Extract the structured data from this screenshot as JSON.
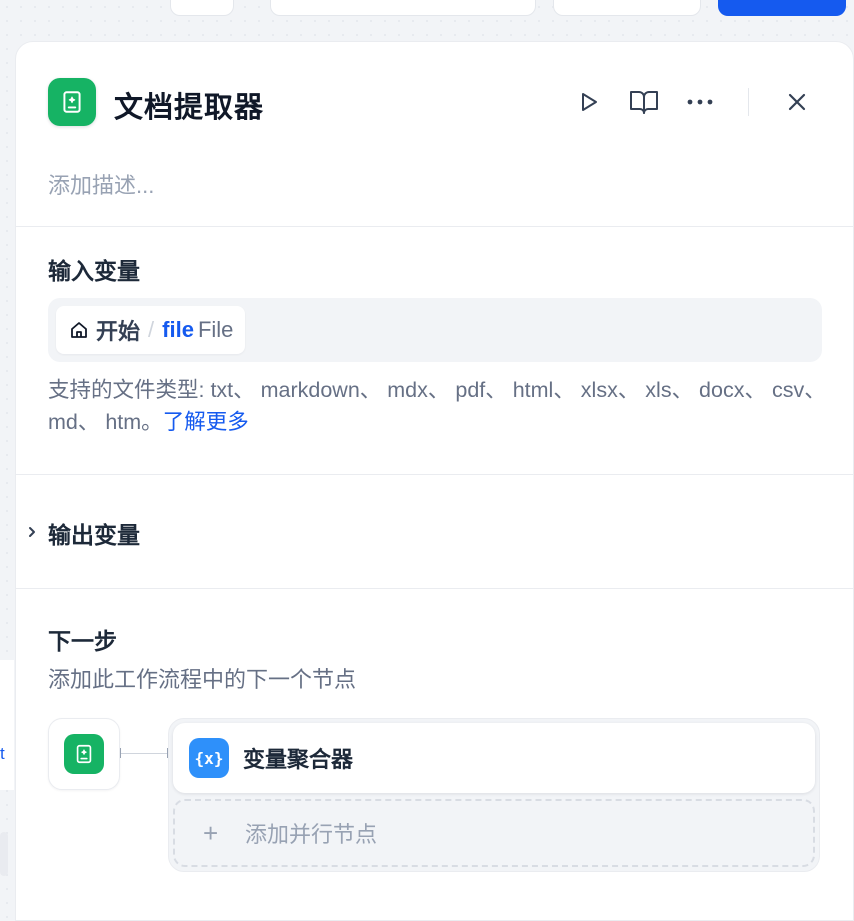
{
  "node": {
    "title": "文档提取器",
    "description_placeholder": "添加描述...",
    "icon": "document-extractor-icon",
    "accent_color": "#16b364"
  },
  "header_actions": [
    "run-icon",
    "docs-book-icon",
    "more-icon",
    "close-icon"
  ],
  "input": {
    "section_title": "输入变量",
    "variable": {
      "node_name": "开始",
      "separator": "/",
      "var_name": "file",
      "var_type": "File"
    },
    "supported_text": "支持的文件类型: txt、 markdown、 mdx、 pdf、 html、 xlsx、 xls、 docx、 csv、 md、 htm。",
    "learn_more": "了解更多"
  },
  "output": {
    "section_title": "输出变量",
    "collapsed": true
  },
  "next_step": {
    "section_title": "下一步",
    "subtitle": "添加此工作流程中的下一个节点",
    "targets": [
      {
        "label": "变量聚合器",
        "icon_text": "{x}",
        "icon_color": "#2e90fa"
      }
    ],
    "add_parallel_label": "添加并行节点"
  },
  "canvas": {
    "left_edge_text": "t"
  }
}
